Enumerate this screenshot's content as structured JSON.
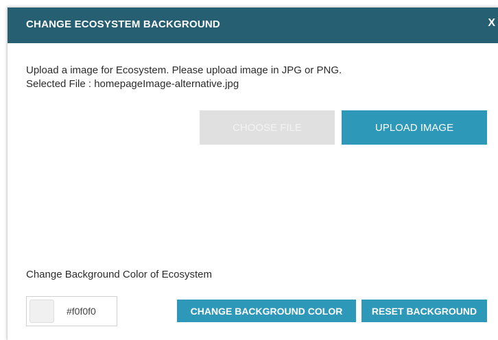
{
  "dialog": {
    "title": "CHANGE ECOSYSTEM BACKGROUND",
    "close_label": "X"
  },
  "upload": {
    "instruction": "Upload a image for Ecosystem. Please upload image in JPG or PNG.",
    "selected_file_text": "Selected File : homepageImage-alternative.jpg",
    "choose_file_label": "CHOOSE FILE",
    "upload_image_label": "UPLOAD IMAGE"
  },
  "background_color": {
    "label": "Change Background Color of Ecosystem",
    "value": "#f0f0f0",
    "change_button_label": "CHANGE BACKGROUND COLOR",
    "reset_button_label": "RESET BACKGROUND"
  },
  "colors": {
    "header": "#265f72",
    "accent": "#2e98b8",
    "disabled_button": "#e0e0e0",
    "swatch": "#f0f0f0"
  }
}
